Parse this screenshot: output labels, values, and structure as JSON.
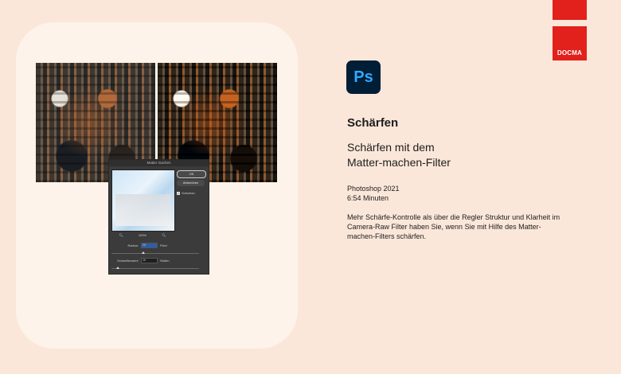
{
  "brand": {
    "logo": "DOCMA",
    "accent": "#e2201c"
  },
  "app_icon": {
    "label": "Ps",
    "bg": "#001e36",
    "fg": "#31a8ff"
  },
  "content": {
    "heading": "Schärfen",
    "subtitle_line1": "Schärfen mit dem",
    "subtitle_line2": "Matter-machen-Filter",
    "version": "Photoshop 2021",
    "duration": "6:54 Minuten",
    "description": "Mehr Schärfe-Kontrolle als über die Regler Struktur und Klarheit im Camera-Raw Filter haben Sie, wenn Sie mit Hilfe des Matter-machen-Filters schärfen."
  },
  "dialog": {
    "title": "Matter machen",
    "ok_label": "OK",
    "cancel_label": "Abbrechen",
    "preview_label": "Vorschau",
    "zoom_value": "100%",
    "radius_label": "Radius:",
    "radius_value": "25",
    "radius_unit": "Pixel",
    "threshold_label": "Schwellenwert:",
    "threshold_value": "15",
    "threshold_unit": "Stufen"
  },
  "icons": {
    "zoom_out": "zoom-out-icon",
    "zoom_in": "zoom-in-icon",
    "checkbox": "checkmark-icon"
  }
}
